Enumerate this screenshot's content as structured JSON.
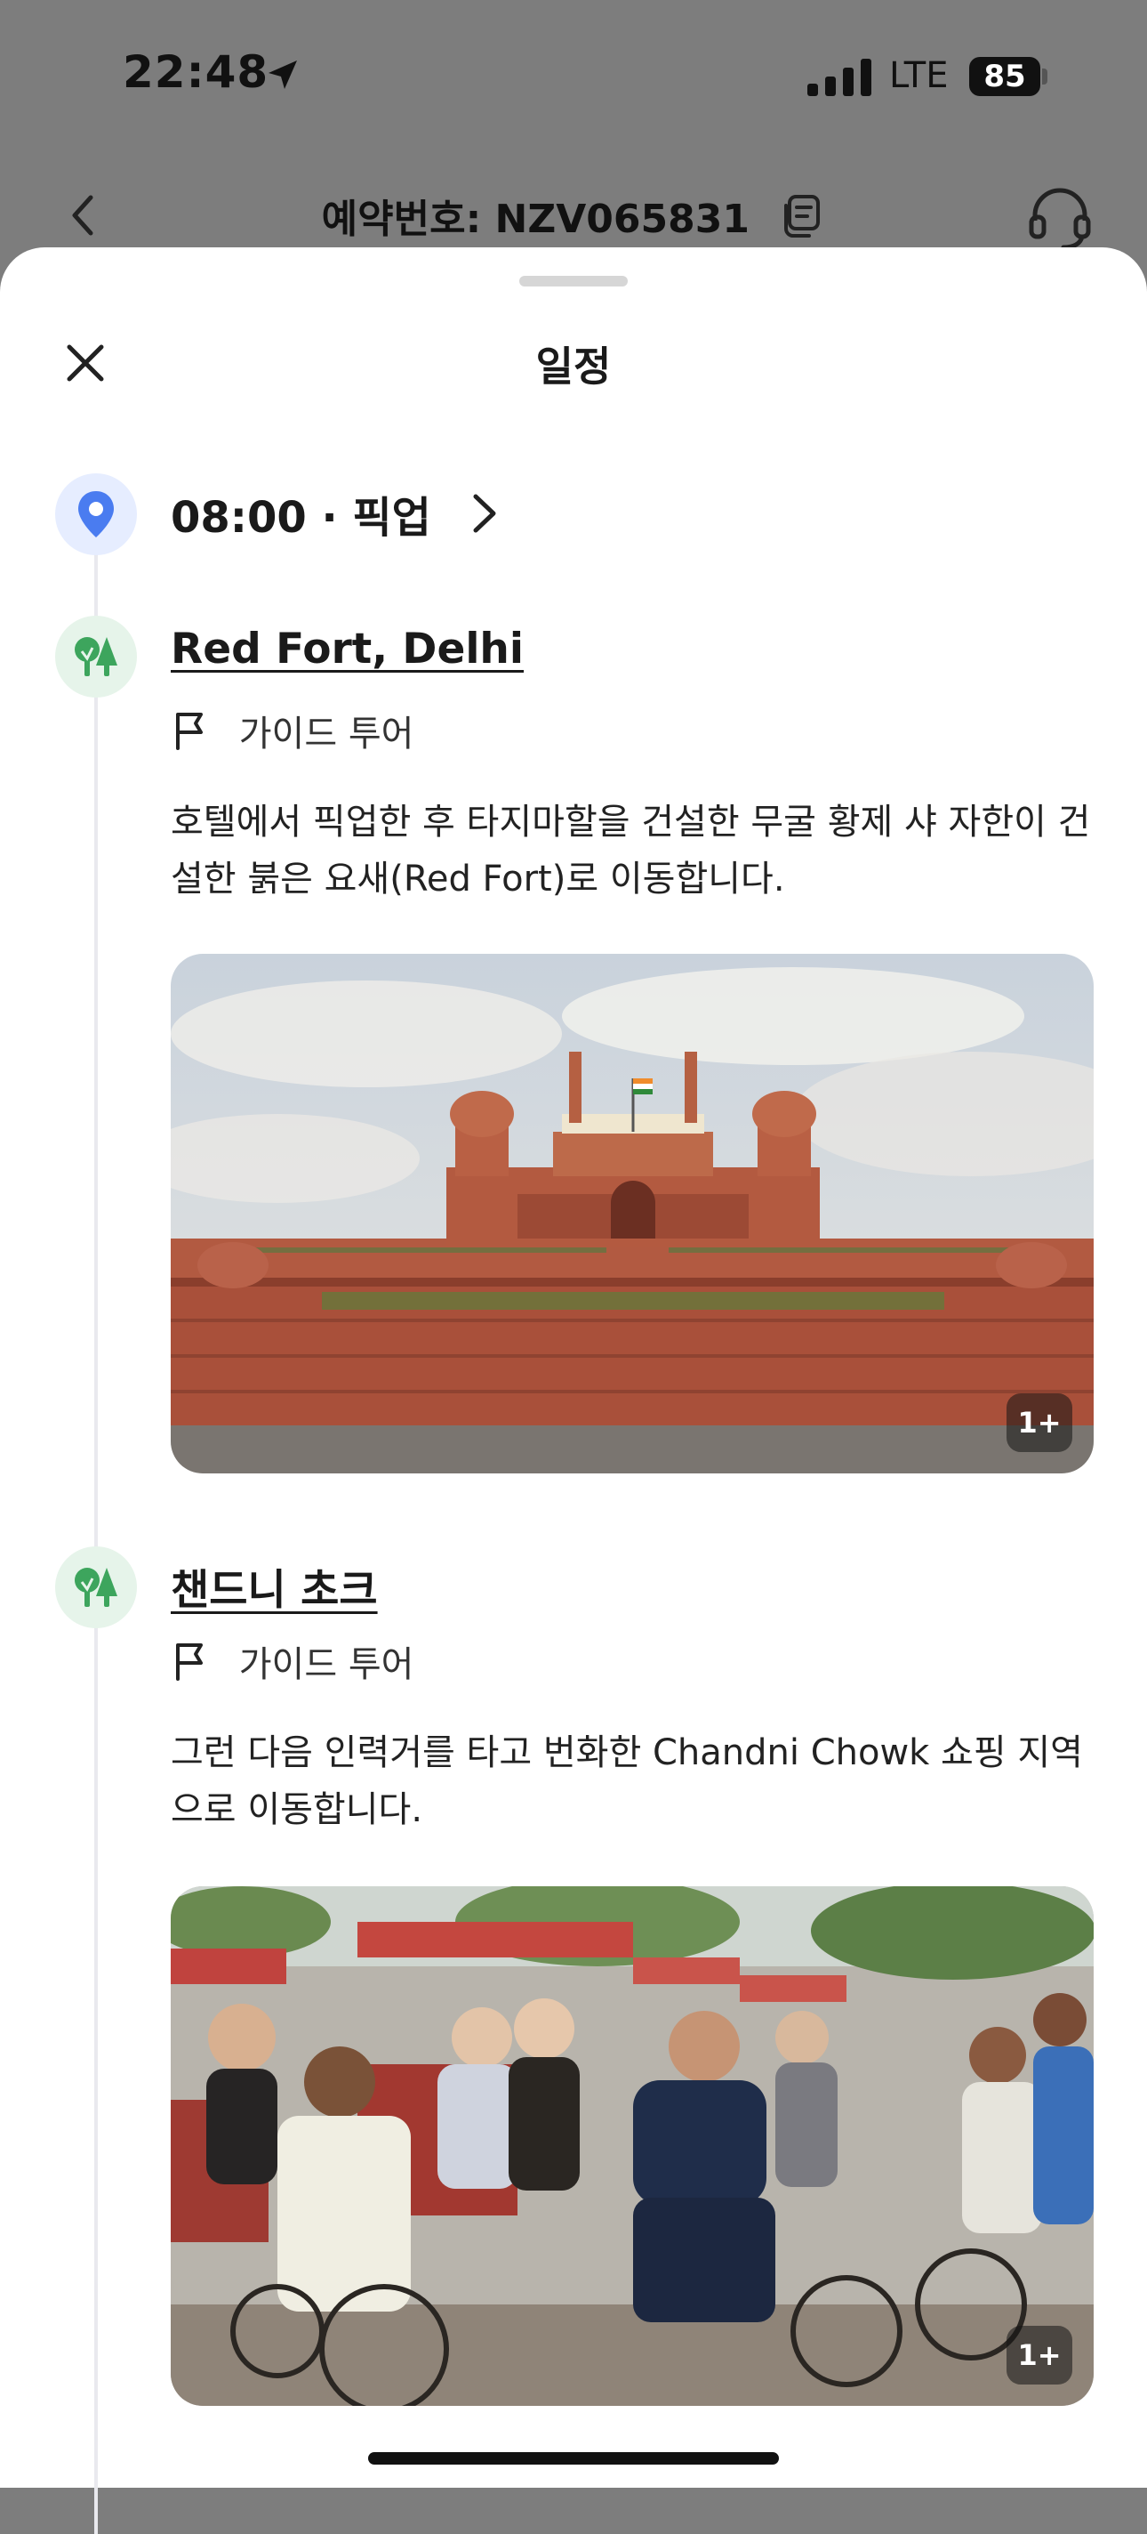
{
  "status_bar": {
    "time": "22:48",
    "network": "LTE",
    "battery": "85"
  },
  "header": {
    "booking_number": "예약번호: NZV065831",
    "icons": [
      "back-icon",
      "copy-icon",
      "support-headset-icon"
    ]
  },
  "sheet": {
    "title": "일정",
    "close_icon": "close-icon"
  },
  "pickup": {
    "label": "08:00 · 픽업",
    "icon": "location-pin-icon"
  },
  "stops": [
    {
      "title": "Red Fort, Delhi",
      "tag": "가이드 투어",
      "description": "호텔에서 픽업한 후 타지마할을 건설한 무굴 황제 샤 자한이 건설한 붉은 요새(Red Fort)로 이동합니다.",
      "photo_count": "1+",
      "icon": "park-trees-icon"
    },
    {
      "title": "챈드니 초크",
      "tag": "가이드 투어",
      "description": "그런 다음 인력거를 타고 번화한 Chandni Chowk 쇼핑 지역으로 이동합니다.",
      "photo_count": "1+",
      "icon": "park-trees-icon"
    }
  ],
  "colors": {
    "accent_blue": "#4a7cf0",
    "accent_green": "#3da55d",
    "fort_red": "#b0533a"
  }
}
